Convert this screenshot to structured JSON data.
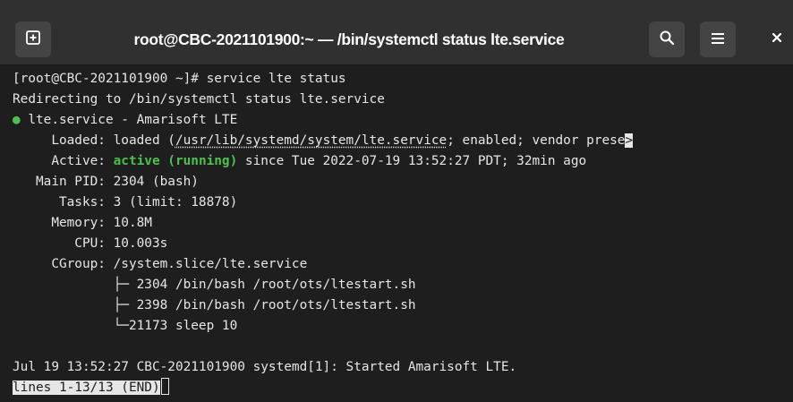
{
  "window": {
    "title": "root@CBC-2021101900:~ — /bin/systemctl status lte.service"
  },
  "toolbar": {
    "new_tab_icon": "new-tab-icon",
    "search_icon": "search-icon",
    "menu_icon": "hamburger-menu-icon",
    "close_icon": "close-icon"
  },
  "terminal": {
    "prompt_line": "[root@CBC-2021101900 ~]# service lte status",
    "redirect_line": "Redirecting to /bin/systemctl status lte.service",
    "unit_dot": "●",
    "unit_line": " lte.service - Amarisoft LTE",
    "loaded_prefix": "     Loaded: loaded (",
    "loaded_path": "/usr/lib/systemd/system/lte.service",
    "loaded_suffix": "; enabled; vendor prese",
    "truncation_marker": ">",
    "active_prefix": "     Active: ",
    "active_status": "active (running)",
    "active_suffix": " since Tue 2022-07-19 13:52:27 PDT; 32min ago",
    "main_pid": "   Main PID: 2304 (bash)",
    "tasks": "      Tasks: 3 (limit: 18878)",
    "memory": "     Memory: 10.8M",
    "cpu": "        CPU: 10.003s",
    "cgroup": "     CGroup: /system.slice/lte.service",
    "cgroup_child_1": "             ├─ 2304 /bin/bash /root/ots/ltestart.sh",
    "cgroup_child_2": "             ├─ 2398 /bin/bash /root/ots/ltestart.sh",
    "cgroup_child_3": "             └─21173 sleep 10",
    "log_line": "Jul 19 13:52:27 CBC-2021101900 systemd[1]: Started Amarisoft LTE.",
    "pager_status": "lines 1-13/13 (END)"
  },
  "colors": {
    "background": "#1e1e1e",
    "titlebar": "#303030",
    "text": "#e6e6e6",
    "active_green": "#4fbf4f"
  }
}
